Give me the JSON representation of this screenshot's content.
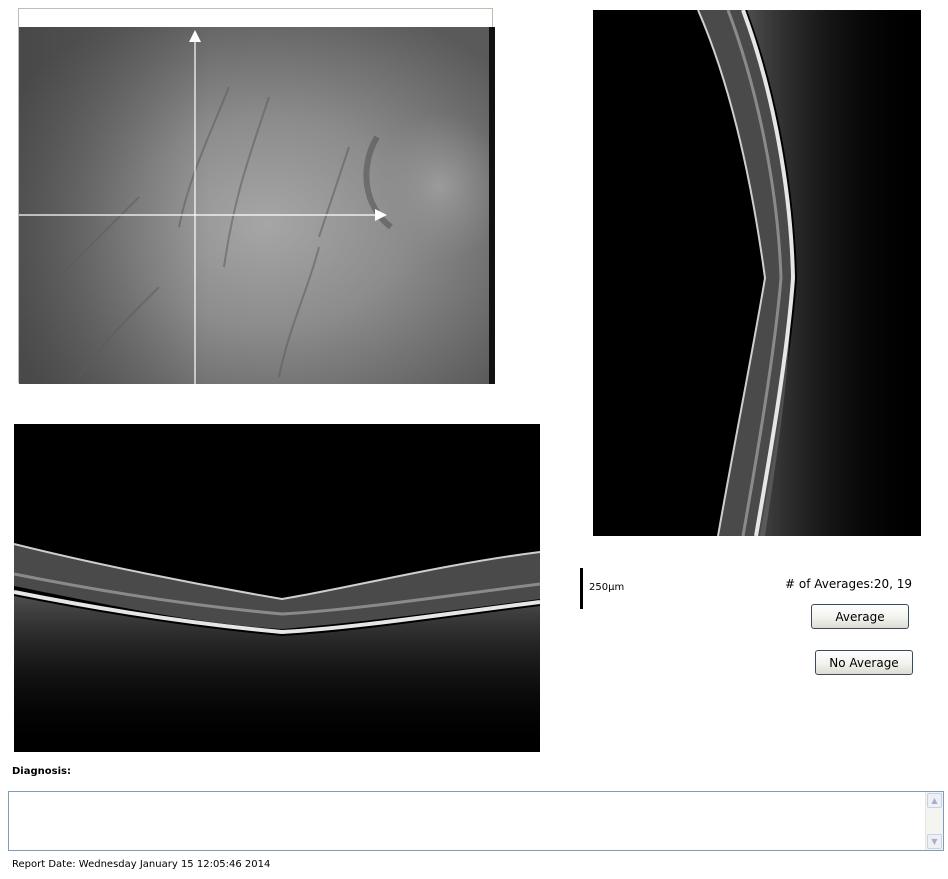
{
  "scale": {
    "label": "250µm"
  },
  "averages": {
    "label": "# of Averages:20, 19"
  },
  "buttons": {
    "average": "Average",
    "no_average": "No Average"
  },
  "diagnosis": {
    "label": "Diagnosis:",
    "value": ""
  },
  "report": {
    "date": "Report Date: Wednesday January 15 12:05:46 2014"
  },
  "icons": {
    "scroll_up": "scroll-up-arrow",
    "scroll_down": "scroll-down-arrow",
    "crosshair_arrow": "arrow-head"
  },
  "colors": {
    "scan_background": "#000000",
    "crosshair": "#ffffff",
    "button_border": "#3c4b5c",
    "textarea_border": "#7f9db9"
  }
}
